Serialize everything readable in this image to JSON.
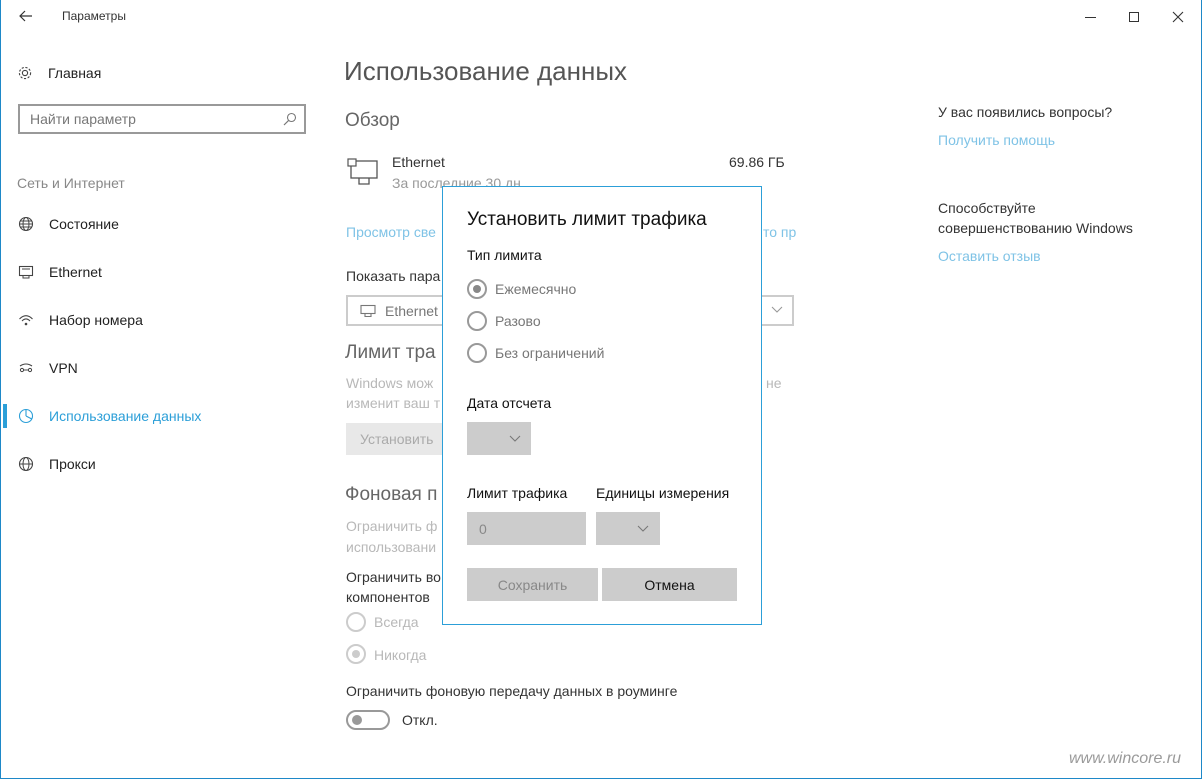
{
  "window": {
    "title": "Параметры"
  },
  "sidebar": {
    "home_label": "Главная",
    "search_placeholder": "Найти параметр",
    "group_label": "Сеть и Интернет",
    "items": [
      {
        "label": "Состояние",
        "icon": "globe-network-icon",
        "active": false
      },
      {
        "label": "Ethernet",
        "icon": "ethernet-icon",
        "active": false
      },
      {
        "label": "Набор номера",
        "icon": "dialup-icon",
        "active": false
      },
      {
        "label": "VPN",
        "icon": "vpn-icon",
        "active": false
      },
      {
        "label": "Использование данных",
        "icon": "data-usage-icon",
        "active": true
      },
      {
        "label": "Прокси",
        "icon": "globe-icon",
        "active": false
      }
    ]
  },
  "main": {
    "title": "Использование данных",
    "overview_heading": "Обзор",
    "connection_name": "Ethernet",
    "connection_period": "За последние 30 дн",
    "connection_usage": "69.86 ГБ",
    "usage_link_left": "Просмотр све",
    "usage_link_right": "то пр",
    "show_params_label": "Показать пара",
    "combo_value": "Ethernet",
    "limit_heading": "Лимит тра",
    "limit_desc_line1": "Windows мож",
    "limit_desc_line1_right": "не",
    "limit_desc_line2": "изменит ваш т",
    "limit_button": "Установить",
    "background_heading": "Фоновая п",
    "bg_desc_line1": "Ограничить ф",
    "bg_desc_line2": "использовани",
    "bg_store_line1": "Ограничить во",
    "bg_store_line2": "компонентов",
    "radio_always": "Всегда",
    "radio_never": "Никогда",
    "roaming_label": "Ограничить фоновую передачу данных в роуминге",
    "toggle_state": "Откл."
  },
  "aside": {
    "questions_heading": "У вас появились вопросы?",
    "help_link": "Получить помощь",
    "feedback_heading_line1": "Способствуйте",
    "feedback_heading_line2": "совершенствованию Windows",
    "feedback_link": "Оставить отзыв"
  },
  "dialog": {
    "title": "Установить лимит трафика",
    "limit_type_label": "Тип лимита",
    "options": [
      {
        "label": "Ежемесячно",
        "checked": true
      },
      {
        "label": "Разово",
        "checked": false
      },
      {
        "label": "Без ограничений",
        "checked": false
      }
    ],
    "reset_date_label": "Дата отсчета",
    "traffic_limit_label": "Лимит трафика",
    "traffic_limit_value": "0",
    "units_label": "Единицы измерения",
    "save_button": "Сохранить",
    "cancel_button": "Отмена"
  },
  "watermark": "www.wincore.ru",
  "colors": {
    "accent": "#2c9fd8",
    "link_disabled": "#7fc3e6",
    "dialog_field": "#cccccc"
  }
}
